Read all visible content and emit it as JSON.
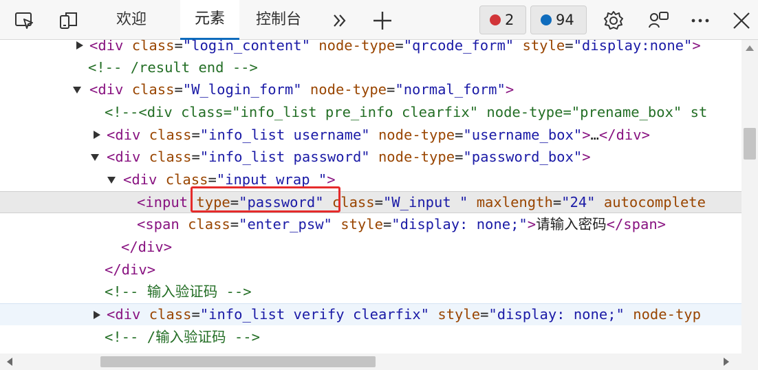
{
  "toolbar": {
    "tabs": [
      {
        "label": "欢迎"
      },
      {
        "label": "元素"
      },
      {
        "label": "控制台"
      }
    ],
    "error_count": "2",
    "issue_count": "94",
    "colors": {
      "accent": "#0f6cbd",
      "error": "#d13438",
      "issue": "#0f6cbd"
    }
  },
  "elements": {
    "lines": [
      {
        "parts": [
          [
            "t",
            "<div "
          ],
          [
            "a",
            "class"
          ],
          [
            "p",
            "="
          ],
          [
            "v",
            "\"login_content\" "
          ],
          [
            "a",
            "node-type"
          ],
          [
            "p",
            "="
          ],
          [
            "v",
            "\"qrcode_form\" "
          ],
          [
            "a",
            "style"
          ],
          [
            "p",
            "="
          ],
          [
            "v",
            "\"display:none\""
          ],
          [
            "t",
            ">"
          ]
        ]
      },
      {
        "parts": [
          [
            "c",
            "<!-- /result end -->"
          ]
        ]
      },
      {
        "parts": [
          [
            "t",
            "<div "
          ],
          [
            "a",
            "class"
          ],
          [
            "p",
            "="
          ],
          [
            "v",
            "\"W_login_form\" "
          ],
          [
            "a",
            "node-type"
          ],
          [
            "p",
            "="
          ],
          [
            "v",
            "\"normal_form\""
          ],
          [
            "t",
            ">"
          ]
        ]
      },
      {
        "parts": [
          [
            "c",
            "<!--<div class=\"info_list pre_info clearfix\" node-type=\"prename_box\" st"
          ]
        ]
      },
      {
        "parts": [
          [
            "t",
            "<div "
          ],
          [
            "a",
            "class"
          ],
          [
            "p",
            "="
          ],
          [
            "v",
            "\"info_list username\" "
          ],
          [
            "a",
            "node-type"
          ],
          [
            "p",
            "="
          ],
          [
            "v",
            "\"username_box\""
          ],
          [
            "t",
            ">"
          ],
          [
            "p",
            "…"
          ],
          [
            "t",
            "</div>"
          ]
        ]
      },
      {
        "parts": [
          [
            "t",
            "<div "
          ],
          [
            "a",
            "class"
          ],
          [
            "p",
            "="
          ],
          [
            "v",
            "\"info_list password\" "
          ],
          [
            "a",
            "node-type"
          ],
          [
            "p",
            "="
          ],
          [
            "v",
            "\"password_box\""
          ],
          [
            "t",
            ">"
          ]
        ]
      },
      {
        "parts": [
          [
            "t",
            "<div "
          ],
          [
            "a",
            "class"
          ],
          [
            "p",
            "="
          ],
          [
            "v",
            "\"input_wrap \""
          ],
          [
            "t",
            ">"
          ]
        ]
      },
      {
        "parts": [
          [
            "t",
            "<input "
          ],
          [
            "a",
            "type"
          ],
          [
            "p",
            "="
          ],
          [
            "v",
            "\"password\" "
          ],
          [
            "a",
            "class"
          ],
          [
            "p",
            "="
          ],
          [
            "v",
            "\"W_input \" "
          ],
          [
            "a",
            "maxlength"
          ],
          [
            "p",
            "="
          ],
          [
            "v",
            "\"24\" "
          ],
          [
            "a",
            "autocomplete"
          ]
        ]
      },
      {
        "parts": [
          [
            "t",
            "<span "
          ],
          [
            "a",
            "class"
          ],
          [
            "p",
            "="
          ],
          [
            "v",
            "\"enter_psw\" "
          ],
          [
            "a",
            "style"
          ],
          [
            "p",
            "="
          ],
          [
            "v",
            "\"display: none;\""
          ],
          [
            "t",
            ">"
          ],
          [
            "pz",
            "请输入密码"
          ],
          [
            "t",
            "</span>"
          ]
        ]
      },
      {
        "parts": [
          [
            "t",
            "</div>"
          ]
        ]
      },
      {
        "parts": [
          [
            "t",
            "</div>"
          ]
        ]
      },
      {
        "parts": [
          [
            "c",
            "<!-- "
          ],
          [
            "cz",
            "输入验证码"
          ],
          [
            "c",
            " -->"
          ]
        ]
      },
      {
        "parts": [
          [
            "t",
            "<div "
          ],
          [
            "a",
            "class"
          ],
          [
            "p",
            "="
          ],
          [
            "v",
            "\"info_list verify clearfix\" "
          ],
          [
            "a",
            "style"
          ],
          [
            "p",
            "="
          ],
          [
            "v",
            "\"display: none;\" "
          ],
          [
            "a",
            "node-typ"
          ]
        ]
      },
      {
        "parts": [
          [
            "c",
            "<!-- /"
          ],
          [
            "cz",
            "输入验证码"
          ],
          [
            "c",
            " -->"
          ]
        ]
      }
    ]
  }
}
